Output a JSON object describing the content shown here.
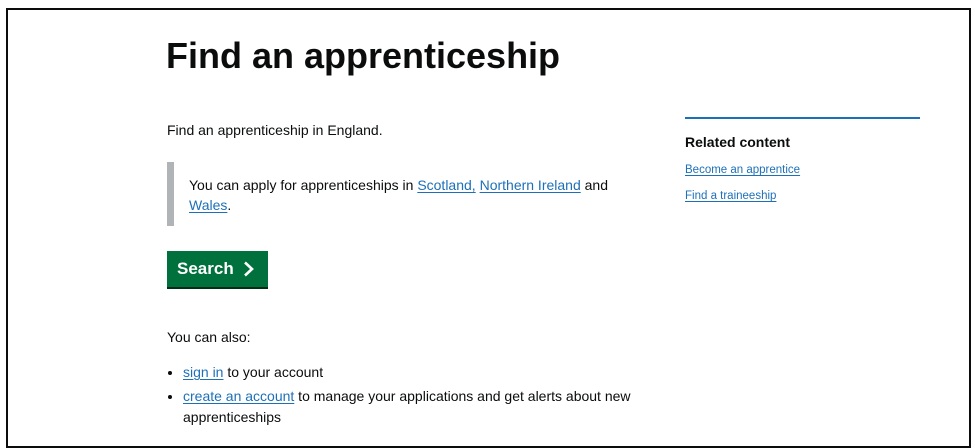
{
  "page": {
    "title": "Find an apprenticeship",
    "lead": "Find an apprenticeship in England."
  },
  "inset": {
    "prefix": "You can apply for apprenticeships in ",
    "link_scotland": "Scotland,",
    "link_ni": "Northern Ireland",
    "and": " and ",
    "link_wales": "Wales",
    "suffix": "."
  },
  "search_button": {
    "label": "Search",
    "icon": "chevron-right-icon",
    "color": "#00703c"
  },
  "also": {
    "heading": "You can also:",
    "items": [
      {
        "link": "sign in",
        "text": " to your account"
      },
      {
        "link": "create an account",
        "text": " to manage your applications and get alerts about new apprenticeships"
      }
    ]
  },
  "related": {
    "heading": "Related content",
    "links": [
      "Become an apprentice",
      "Find a traineeship"
    ],
    "accent": "#1d70b8"
  }
}
